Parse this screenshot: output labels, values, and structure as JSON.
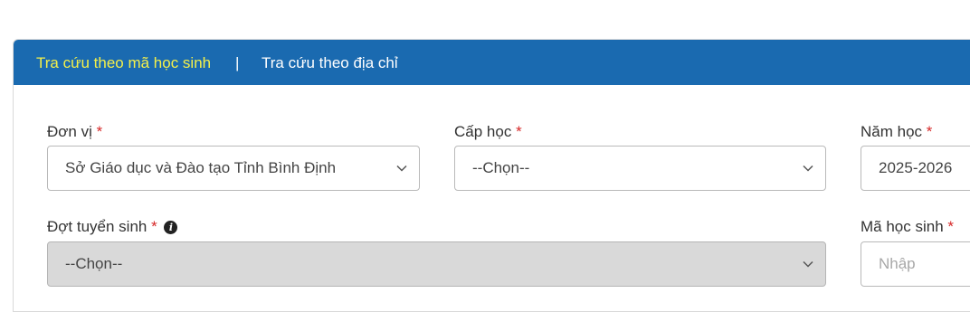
{
  "tabs": {
    "active_label": "Tra cứu theo mã học sinh",
    "separator": "|",
    "inactive_label": "Tra cứu theo địa chỉ",
    "active_color": "#f4f04a",
    "bar_color": "#1a6ab0"
  },
  "fields": {
    "don_vi": {
      "label": "Đơn vị",
      "required_mark": "*",
      "value": "Sở Giáo dục và Đào tạo Tỉnh Bình Định",
      "icon": "chevron-down-icon"
    },
    "cap_hoc": {
      "label": "Cấp học",
      "required_mark": "*",
      "value": "--Chọn--",
      "icon": "chevron-down-icon"
    },
    "nam_hoc": {
      "label": "Năm học",
      "required_mark": "*",
      "value": "2025-2026"
    },
    "dot_tuyen_sinh": {
      "label": "Đợt tuyển sinh",
      "required_mark": "*",
      "info_glyph": "i",
      "value": "--Chọn--",
      "icon": "chevron-down-icon",
      "disabled": true
    },
    "ma_hoc_sinh": {
      "label": "Mã học sinh",
      "required_mark": "*",
      "placeholder": "Nhập"
    }
  }
}
